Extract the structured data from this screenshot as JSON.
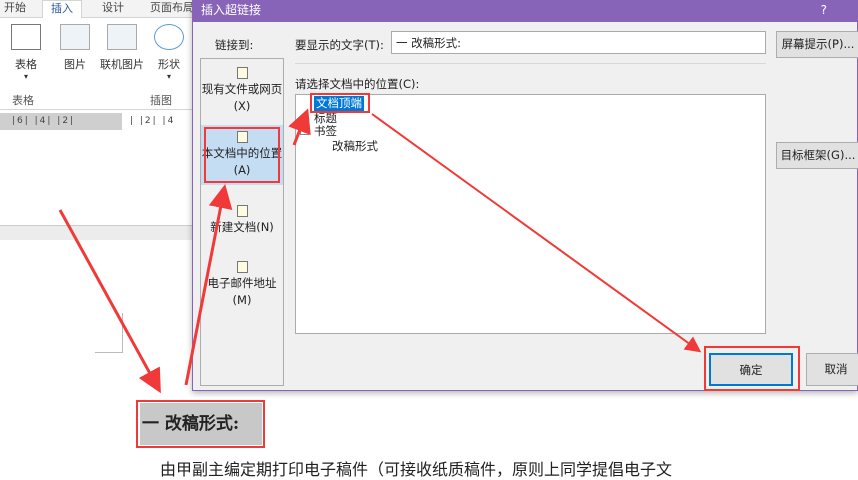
{
  "ribbon": {
    "tabs": [
      "开始",
      "插入",
      "设计",
      "页面布局"
    ],
    "active_tab": "插入",
    "buttons": [
      "表格",
      "图片",
      "联机图片",
      "形状"
    ],
    "groups": [
      "表格",
      "插图"
    ]
  },
  "ruler": {
    "left": "|6| |4| |2| ",
    "right": "| |2| |4"
  },
  "dialog": {
    "title": "插入超链接",
    "help": "?",
    "link_to_label": "链接到:",
    "link_options": [
      "现有文件或网页(X)",
      "本文档中的位置(A)",
      "新建文档(N)",
      "电子邮件地址(M)"
    ],
    "display_text_label": "要显示的文字(T):",
    "display_text_value": "一 改稿形式:",
    "screen_tip_button": "屏幕提示(P)...",
    "select_place_label": "请选择文档中的位置(C):",
    "tree": [
      "文档顶端",
      "标题",
      "书签",
      "改稿形式"
    ],
    "target_frame_button": "目标框架(G)...",
    "ok_button": "确定",
    "cancel_button": "取消"
  },
  "document": {
    "heading": "一 改稿形式:",
    "body": "由甲副主编定期打印电子稿件（可接收纸质稿件，原则上同学提倡电子文"
  }
}
